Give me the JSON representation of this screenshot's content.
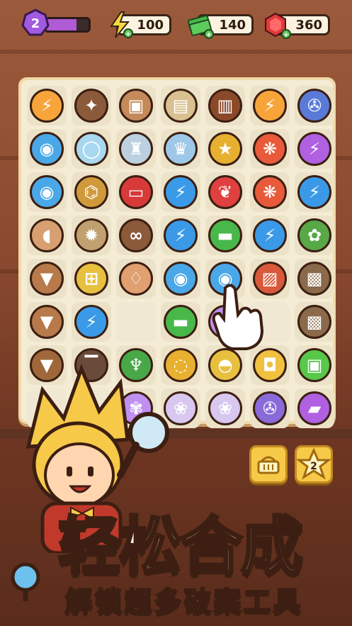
{
  "hud": {
    "level": "2",
    "xp_progress": 0.72,
    "energy": "100",
    "cash": "140",
    "gems": "360"
  },
  "side_buttons": {
    "basket_icon": "basket-icon",
    "star_count": "2"
  },
  "title": "轻松合成",
  "subtitle": "解锁超多破案工具",
  "colors": {
    "board_bg": "#f5ecd6",
    "accent_gold": "#f7c948",
    "text_outline": "#3c1f12",
    "xp_purple": "#b05ad6"
  },
  "board_items": [
    [
      "lightning-orb",
      "puzzle-piece",
      "photo-frame",
      "wanted-poster",
      "case-folder",
      "lightning-orb",
      "telescope-cart"
    ],
    [
      "magnifier-small",
      "crystal-ball",
      "trophy-cup",
      "glass-trophy",
      "star-trophy",
      "red-pretzel",
      "purple-lightning-orb"
    ],
    [
      "magnifier-small",
      "brass-spyglass",
      "red-box",
      "blue-lightning",
      "red-wing",
      "red-pretzel",
      "blue-lightning"
    ],
    [
      "broken-pot",
      "gear-lightning-badge",
      "footprints",
      "blue-lightning",
      "cash-stack",
      "blue-lightning",
      "potted-plant"
    ],
    [
      "clay-pot",
      "barrier",
      "vase",
      "magnifier-large",
      "magnifier-large",
      "tool-crate",
      "wooden-crate"
    ],
    [
      "clay-pot",
      "blue-lightning",
      "",
      "cash-stack",
      "purple-flower",
      "",
      "wooden-crate"
    ],
    [
      "soil-pot",
      "bench",
      "broom",
      "yellow-ring",
      "yellow-bag",
      "water-bucket",
      "green-box"
    ],
    [
      "",
      "",
      "purple-flower",
      "cotton-tree",
      "cotton-tree",
      "toy-vehicle",
      "toy-car"
    ]
  ]
}
